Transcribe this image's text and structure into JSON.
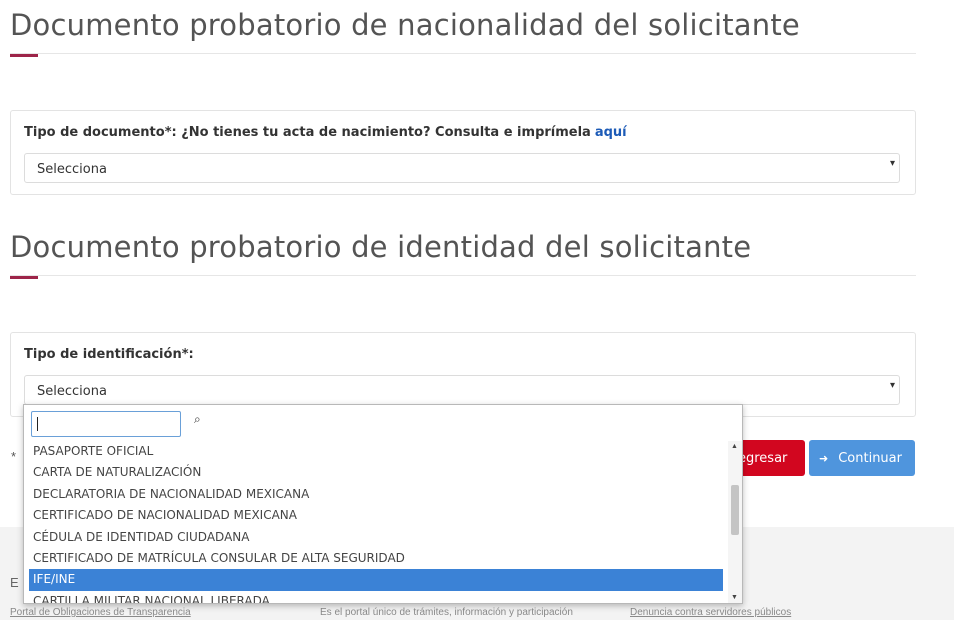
{
  "section_nationality": {
    "title": "Documento probatorio de nacionalidad del solicitante",
    "field_label": "Tipo de documento*: ¿No tienes tu acta de nacimiento? Consulta e imprímela",
    "field_link": "aquí",
    "select_value": "Selecciona"
  },
  "section_identity": {
    "title": "Documento probatorio de identidad del solicitante",
    "field_label": "Tipo de identificación*:",
    "select_value": "Selecciona"
  },
  "dropdown": {
    "search_value": "",
    "options": [
      "PASAPORTE OFICIAL",
      "CARTA DE NATURALIZACIÓN",
      "DECLARATORIA DE NACIONALIDAD MEXICANA",
      "CERTIFICADO DE NACIONALIDAD MEXICANA",
      "CÉDULA DE IDENTIDAD CIUDADANA",
      "CERTIFICADO DE MATRÍCULA CONSULAR DE ALTA SEGURIDAD",
      "IFE/INE",
      "CARTILLA MILITAR NACIONAL LIBERADA"
    ],
    "selected_option": "IFE/INE"
  },
  "buttons": {
    "back_label": "egresar",
    "continue_label": "Continuar"
  },
  "asterisk": "*",
  "footer": {
    "partial_text": "E",
    "links": [
      "Portal de Obligaciones de Transparencia",
      "Es el portal único de trámites, información y participación",
      "Denuncia contra servidores públicos"
    ]
  },
  "icons": {
    "search": "search-icon",
    "select_caret": "caret-down-icon",
    "continue_arrow": "arrow-right-icon"
  },
  "colors": {
    "accent": "#9d2449",
    "back_button": "#d2061f",
    "continue_button": "#4f95dd",
    "link": "#1d5bb7",
    "selected_option": "#3b82d6"
  }
}
